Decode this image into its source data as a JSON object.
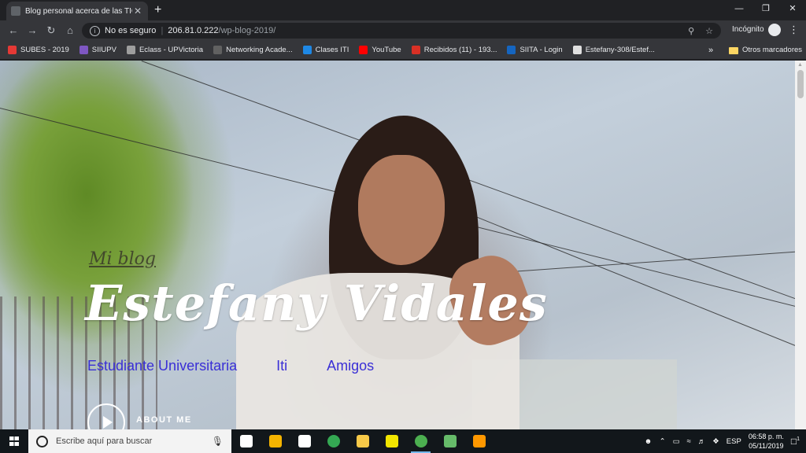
{
  "browser": {
    "tab_title": "Blog personal acerca de las TICS",
    "tab_close": "✕",
    "new_tab": "+",
    "window_controls": {
      "minimize": "—",
      "maximize": "❐",
      "close": "✕"
    },
    "security_label": "No es seguro",
    "url_host": "206.81.0.222",
    "url_path": "/wp-blog-2019/",
    "incognito_label": "Incógnito"
  },
  "bookmarks": [
    {
      "label": "SUBES - 2019",
      "icon": "subes-icon",
      "color": "#e53935"
    },
    {
      "label": "SIIUPV",
      "icon": "siiupv-icon",
      "color": "#7e57c2"
    },
    {
      "label": "Eclass - UPVictoria",
      "icon": "eclass-icon",
      "color": "#9e9e9e"
    },
    {
      "label": "Networking Acade...",
      "icon": "cisco-icon",
      "color": "#616161"
    },
    {
      "label": "Clases ITI",
      "icon": "classroom-icon",
      "color": "#1e88e5"
    },
    {
      "label": "YouTube",
      "icon": "youtube-icon",
      "color": "#ff0000"
    },
    {
      "label": "Recibidos (11) - 193...",
      "icon": "gmail-icon",
      "color": "#d93025"
    },
    {
      "label": "SIITA - Login",
      "icon": "siita-icon",
      "color": "#1565c0"
    },
    {
      "label": "Estefany-308/Estef...",
      "icon": "github-icon",
      "color": "#e0e0e0"
    }
  ],
  "bookmarks_more": "»",
  "other_bookmarks": "Otros marcadores",
  "page": {
    "blog_label": "Mi blog",
    "blog_title": "Estefany Vidales",
    "menu": [
      "Estudiante Universitaria",
      "Iti",
      "Amigos"
    ],
    "about_label": "ABOUT ME"
  },
  "taskbar": {
    "search_placeholder": "Escribe aquí para buscar",
    "apps": [
      {
        "name": "task-view",
        "color": "#ffffff"
      },
      {
        "name": "store",
        "color": "#f5b400"
      },
      {
        "name": "mail",
        "color": "#ffffff"
      },
      {
        "name": "chrome",
        "color": "#34a853"
      },
      {
        "name": "file-explorer",
        "color": "#f7c948"
      },
      {
        "name": "sticky-notes",
        "color": "#f2e600"
      },
      {
        "name": "chrome-incognito",
        "color": "#4caf50"
      },
      {
        "name": "git",
        "color": "#66bb6a"
      },
      {
        "name": "sublime-text",
        "color": "#ff9800"
      }
    ],
    "language": "ESP",
    "time": "06:58 p. m.",
    "date": "05/11/2019",
    "notification_count": "1"
  }
}
